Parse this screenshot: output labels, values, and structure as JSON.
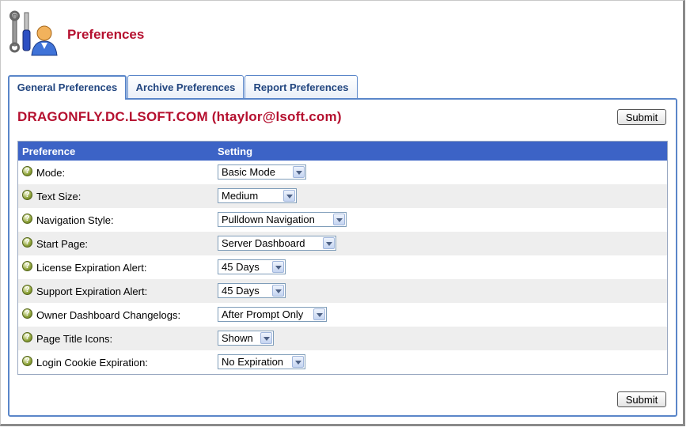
{
  "header": {
    "title": "Preferences"
  },
  "tabs": [
    {
      "label": "General Preferences",
      "active": true
    },
    {
      "label": "Archive Preferences",
      "active": false
    },
    {
      "label": "Report Preferences",
      "active": false
    }
  ],
  "panel": {
    "server_title": "DRAGONFLY.DC.LSOFT.COM (htaylor@lsoft.com)",
    "submit_label": "Submit"
  },
  "table": {
    "headers": {
      "preference": "Preference",
      "setting": "Setting"
    },
    "rows": [
      {
        "label": "Mode:",
        "value": "Basic Mode"
      },
      {
        "label": "Text Size:",
        "value": "Medium"
      },
      {
        "label": "Navigation Style:",
        "value": "Pulldown Navigation"
      },
      {
        "label": "Start Page:",
        "value": "Server Dashboard"
      },
      {
        "label": "License Expiration Alert:",
        "value": "45 Days"
      },
      {
        "label": "Support Expiration Alert:",
        "value": "45 Days"
      },
      {
        "label": "Owner Dashboard Changelogs:",
        "value": "After Prompt Only"
      },
      {
        "label": "Page Title Icons:",
        "value": "Shown"
      },
      {
        "label": "Login Cookie Expiration:",
        "value": "No Expiration"
      }
    ]
  },
  "colors": {
    "accent": "#b5102f",
    "header_bg": "#3c63c6",
    "tab_border": "#5a86c9"
  },
  "icons": {
    "header": "tools-user-icon",
    "help": "help-icon"
  }
}
